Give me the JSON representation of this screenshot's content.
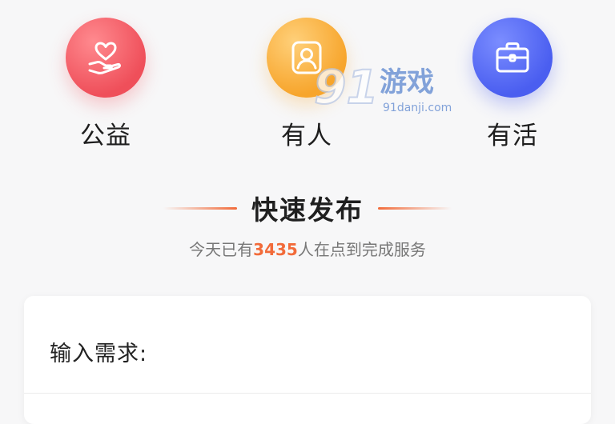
{
  "categories": [
    {
      "label": "公益",
      "icon": "heart-hand-icon",
      "color": "#ef4f5a"
    },
    {
      "label": "有人",
      "icon": "person-frame-icon",
      "color": "#f7a52c"
    },
    {
      "label": "有活",
      "icon": "briefcase-icon",
      "color": "#4a5ef0"
    }
  ],
  "watermark": {
    "text": "游戏",
    "num": "91",
    "url": "91danji.com"
  },
  "quick_publish": {
    "title": "快速发布",
    "stats_prefix": "今天已有",
    "stats_count": "3435",
    "stats_suffix": "人在点到完成服务",
    "accent_color": "#f26b3a"
  },
  "input_card": {
    "prompt": "输入需求:"
  }
}
